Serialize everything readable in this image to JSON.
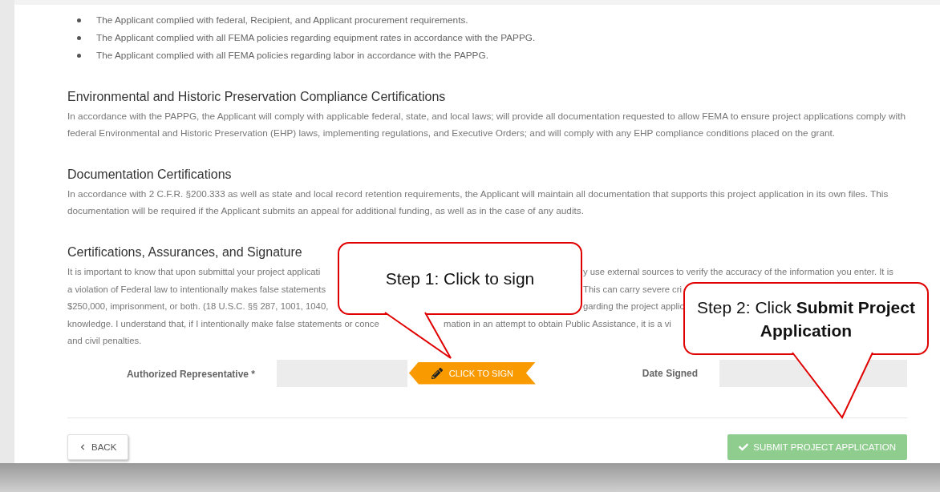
{
  "requirements": [
    "The Applicant complied with federal, Recipient, and Applicant procurement requirements.",
    "The Applicant complied with all FEMA policies regarding equipment rates in accordance with the PAPPG.",
    "The Applicant complied with all FEMA policies regarding labor in accordance with the PAPPG."
  ],
  "sections": [
    {
      "heading": "Environmental and Historic Preservation Compliance Certifications",
      "body": "In accordance with the PAPPG, the Applicant will comply with applicable federal, state, and local laws; will provide all documentation requested to allow FEMA to ensure project applications comply with federal Environmental and Historic Preservation (EHP) laws, implementing regulations, and Executive Orders; and will comply with any EHP compliance conditions placed on the grant."
    },
    {
      "heading": "Documentation Certifications",
      "body": "In accordance with 2 C.F.R. §200.333 as well as state and local record retention requirements, the Applicant will maintain all documentation that supports this project application in its own files. This documentation will be required if the Applicant submits an appeal for additional funding, as well as in the case of any audits."
    }
  ],
  "signature_section": {
    "heading": "Certifications, Assurances, and Signature",
    "lines": [
      {
        "segments": [
          "It is important to know that upon submittal your project applicati",
          "y use external sources to verify the accuracy of the information you enter. It is"
        ]
      },
      {
        "segments": [
          "a violation of Federal law to intentionally makes false statements",
          "This can carry severe cri"
        ]
      },
      {
        "segments": [
          "$250,000, imprisonment, or both. (18 U.S.C. §§ 287, 1001, 1040,",
          "garding the project applic"
        ]
      },
      {
        "segments": [
          "knowledge. I understand that, if I intentionally make false statements or conce",
          "mation in an attempt to obtain Public Assistance, it is a vi"
        ]
      },
      {
        "segments": [
          "and civil penalties."
        ]
      }
    ],
    "representative_label": "Authorized Representative *",
    "sign_button": "CLICK TO SIGN",
    "date_label": "Date Signed"
  },
  "buttons": {
    "back": "BACK",
    "submit": "SUBMIT PROJECT APPLICATION",
    "submit_disabled": true
  },
  "callouts": [
    "Step 1: Click to sign",
    "Step 2: Click **Submit Project Application**"
  ]
}
